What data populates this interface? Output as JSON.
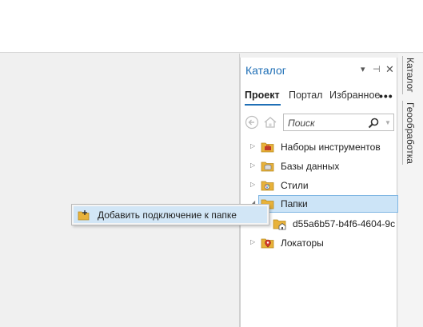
{
  "catalog": {
    "title": "Каталог",
    "tabs": [
      {
        "label": "Проект",
        "active": true
      },
      {
        "label": "Портал",
        "active": false
      },
      {
        "label": "Избранное",
        "active": false
      }
    ],
    "more_label": "•••",
    "search": {
      "placeholder": "Поиск"
    },
    "tree": [
      {
        "label": "Наборы инструментов",
        "icon": "toolbox-folder-icon"
      },
      {
        "label": "Базы данных",
        "icon": "database-folder-icon"
      },
      {
        "label": "Стили",
        "icon": "styles-folder-icon"
      },
      {
        "label": "Папки",
        "icon": "folder-icon",
        "selected": true,
        "expanded": true
      },
      {
        "label": "d55a6b57-b4f6-4604-9c",
        "icon": "home-folder-icon",
        "child": true
      },
      {
        "label": "Локаторы",
        "icon": "locator-folder-icon"
      }
    ]
  },
  "side_tabs": [
    "Каталог",
    "Геообработка"
  ],
  "context_menu": {
    "items": [
      {
        "label": "Добавить подключение к папке",
        "icon": "add-folder-connection-icon"
      }
    ]
  },
  "colors": {
    "accent": "#1f6fb6",
    "selection": "#cce4f7",
    "folder": "#e8b23a"
  }
}
